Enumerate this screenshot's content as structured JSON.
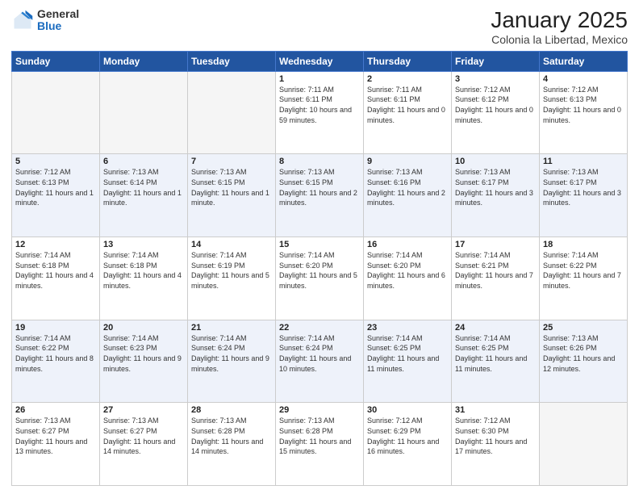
{
  "header": {
    "logo_general": "General",
    "logo_blue": "Blue",
    "title": "January 2025",
    "subtitle": "Colonia la Libertad, Mexico"
  },
  "days_of_week": [
    "Sunday",
    "Monday",
    "Tuesday",
    "Wednesday",
    "Thursday",
    "Friday",
    "Saturday"
  ],
  "weeks": [
    [
      {
        "day": "",
        "info": ""
      },
      {
        "day": "",
        "info": ""
      },
      {
        "day": "",
        "info": ""
      },
      {
        "day": "1",
        "info": "Sunrise: 7:11 AM\nSunset: 6:11 PM\nDaylight: 10 hours and 59 minutes."
      },
      {
        "day": "2",
        "info": "Sunrise: 7:11 AM\nSunset: 6:11 PM\nDaylight: 11 hours and 0 minutes."
      },
      {
        "day": "3",
        "info": "Sunrise: 7:12 AM\nSunset: 6:12 PM\nDaylight: 11 hours and 0 minutes."
      },
      {
        "day": "4",
        "info": "Sunrise: 7:12 AM\nSunset: 6:13 PM\nDaylight: 11 hours and 0 minutes."
      }
    ],
    [
      {
        "day": "5",
        "info": "Sunrise: 7:12 AM\nSunset: 6:13 PM\nDaylight: 11 hours and 1 minute."
      },
      {
        "day": "6",
        "info": "Sunrise: 7:13 AM\nSunset: 6:14 PM\nDaylight: 11 hours and 1 minute."
      },
      {
        "day": "7",
        "info": "Sunrise: 7:13 AM\nSunset: 6:15 PM\nDaylight: 11 hours and 1 minute."
      },
      {
        "day": "8",
        "info": "Sunrise: 7:13 AM\nSunset: 6:15 PM\nDaylight: 11 hours and 2 minutes."
      },
      {
        "day": "9",
        "info": "Sunrise: 7:13 AM\nSunset: 6:16 PM\nDaylight: 11 hours and 2 minutes."
      },
      {
        "day": "10",
        "info": "Sunrise: 7:13 AM\nSunset: 6:17 PM\nDaylight: 11 hours and 3 minutes."
      },
      {
        "day": "11",
        "info": "Sunrise: 7:13 AM\nSunset: 6:17 PM\nDaylight: 11 hours and 3 minutes."
      }
    ],
    [
      {
        "day": "12",
        "info": "Sunrise: 7:14 AM\nSunset: 6:18 PM\nDaylight: 11 hours and 4 minutes."
      },
      {
        "day": "13",
        "info": "Sunrise: 7:14 AM\nSunset: 6:18 PM\nDaylight: 11 hours and 4 minutes."
      },
      {
        "day": "14",
        "info": "Sunrise: 7:14 AM\nSunset: 6:19 PM\nDaylight: 11 hours and 5 minutes."
      },
      {
        "day": "15",
        "info": "Sunrise: 7:14 AM\nSunset: 6:20 PM\nDaylight: 11 hours and 5 minutes."
      },
      {
        "day": "16",
        "info": "Sunrise: 7:14 AM\nSunset: 6:20 PM\nDaylight: 11 hours and 6 minutes."
      },
      {
        "day": "17",
        "info": "Sunrise: 7:14 AM\nSunset: 6:21 PM\nDaylight: 11 hours and 7 minutes."
      },
      {
        "day": "18",
        "info": "Sunrise: 7:14 AM\nSunset: 6:22 PM\nDaylight: 11 hours and 7 minutes."
      }
    ],
    [
      {
        "day": "19",
        "info": "Sunrise: 7:14 AM\nSunset: 6:22 PM\nDaylight: 11 hours and 8 minutes."
      },
      {
        "day": "20",
        "info": "Sunrise: 7:14 AM\nSunset: 6:23 PM\nDaylight: 11 hours and 9 minutes."
      },
      {
        "day": "21",
        "info": "Sunrise: 7:14 AM\nSunset: 6:24 PM\nDaylight: 11 hours and 9 minutes."
      },
      {
        "day": "22",
        "info": "Sunrise: 7:14 AM\nSunset: 6:24 PM\nDaylight: 11 hours and 10 minutes."
      },
      {
        "day": "23",
        "info": "Sunrise: 7:14 AM\nSunset: 6:25 PM\nDaylight: 11 hours and 11 minutes."
      },
      {
        "day": "24",
        "info": "Sunrise: 7:14 AM\nSunset: 6:25 PM\nDaylight: 11 hours and 11 minutes."
      },
      {
        "day": "25",
        "info": "Sunrise: 7:13 AM\nSunset: 6:26 PM\nDaylight: 11 hours and 12 minutes."
      }
    ],
    [
      {
        "day": "26",
        "info": "Sunrise: 7:13 AM\nSunset: 6:27 PM\nDaylight: 11 hours and 13 minutes."
      },
      {
        "day": "27",
        "info": "Sunrise: 7:13 AM\nSunset: 6:27 PM\nDaylight: 11 hours and 14 minutes."
      },
      {
        "day": "28",
        "info": "Sunrise: 7:13 AM\nSunset: 6:28 PM\nDaylight: 11 hours and 14 minutes."
      },
      {
        "day": "29",
        "info": "Sunrise: 7:13 AM\nSunset: 6:28 PM\nDaylight: 11 hours and 15 minutes."
      },
      {
        "day": "30",
        "info": "Sunrise: 7:12 AM\nSunset: 6:29 PM\nDaylight: 11 hours and 16 minutes."
      },
      {
        "day": "31",
        "info": "Sunrise: 7:12 AM\nSunset: 6:30 PM\nDaylight: 11 hours and 17 minutes."
      },
      {
        "day": "",
        "info": ""
      }
    ]
  ]
}
